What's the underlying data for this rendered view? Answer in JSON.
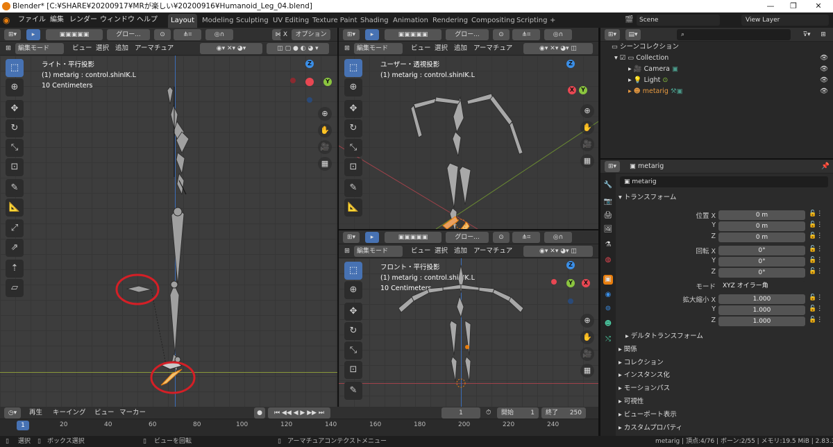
{
  "window": {
    "title": "Blender* [C:¥SHARE¥20200917¥MRが楽しい¥20200916¥Humanoid_Leg_04.blend]",
    "min": "—",
    "max": "❐",
    "close": "✕"
  },
  "menu": [
    "ファイル",
    "編集",
    "レンダー",
    "ウィンドウ",
    "ヘルプ"
  ],
  "workspaces": [
    "Layout",
    "Modeling",
    "Sculpting",
    "UV Editing",
    "Texture Paint",
    "Shading",
    "Animation",
    "Rendering",
    "Compositing",
    "Scripting",
    "+"
  ],
  "scene": {
    "name": "Scene",
    "view_layer": "View Layer"
  },
  "viewport_header": {
    "mode": "編集モード",
    "menus": [
      "ビュー",
      "選択",
      "追加",
      "アーマチュア"
    ],
    "orientation": "グロー...",
    "options": "オプション"
  },
  "viewports": {
    "left": {
      "title": "ライト・平行投影",
      "object": "(1) metarig : control.shinIK.L",
      "scale": "10 Centimeters"
    },
    "top": {
      "title": "ユーザー・透視投影",
      "object": "(1) metarig : control.shinIK.L"
    },
    "bottom": {
      "title": "フロント・平行投影",
      "object": "(1) metarig : control.shinIK.L",
      "scale": "10 Centimeters"
    }
  },
  "gizmo": {
    "x": "X",
    "y": "Y",
    "z": "Z"
  },
  "outliner": {
    "root": "シーンコレクション",
    "collection": "Collection",
    "items": [
      "Camera",
      "Light",
      "metarig"
    ]
  },
  "properties": {
    "object_name": "metarig",
    "datablock": "metarig",
    "transform_header": "トランスフォーム",
    "location_label": "位置 X",
    "location": [
      "0 m",
      "0 m",
      "0 m"
    ],
    "rotation_label": "回転 X",
    "rotation": [
      "0°",
      "0°",
      "0°"
    ],
    "mode_label": "モード",
    "mode_value": "XYZ オイラー角",
    "scale_label": "拡大縮小 X",
    "scale": [
      "1.000",
      "1.000",
      "1.000"
    ],
    "axis_y": "Y",
    "axis_z": "Z",
    "delta": "デルタトランスフォーム",
    "sections": [
      "関係",
      "コレクション",
      "インスタンス化",
      "モーションパス",
      "可視性",
      "ビューポート表示",
      "カスタムプロパティ"
    ]
  },
  "timeline": {
    "menus": [
      "再生",
      "キーイング",
      "ビュー",
      "マーカー"
    ],
    "current": "1",
    "start_label": "開始",
    "start": "1",
    "end_label": "終了",
    "end": "250",
    "ticks": [
      "1",
      "20",
      "40",
      "60",
      "80",
      "100",
      "120",
      "140",
      "160",
      "180",
      "200",
      "220",
      "240"
    ]
  },
  "status": {
    "select": "選択",
    "box": "ボックス選択",
    "rotate": "ビューを回転",
    "context": "アーマチュアコンテクストメニュー",
    "info": "metarig | 頂点:4/76 | ボーン:2/55 | メモリ:19.5 MiB | 2.83.3"
  },
  "colors": {
    "accent": "#4772b3",
    "x_axis": "#e84752",
    "y_axis": "#8bc53f",
    "z_axis": "#3b8fe8",
    "highlight": "#e87d0d",
    "circle": "#d41f26"
  }
}
